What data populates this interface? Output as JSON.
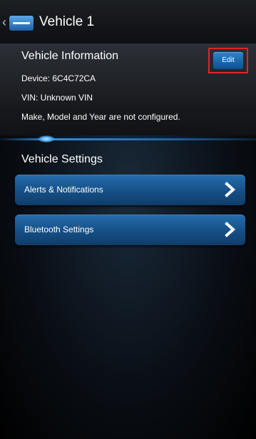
{
  "action_bar": {
    "title": "Vehicle 1",
    "up_caret": "‹"
  },
  "vehicle_information": {
    "header": "Vehicle Information",
    "device": "Device: 6C4C72CA",
    "vin": "VIN: Unknown VIN",
    "make_model_year": "Make, Model and Year are not configured.",
    "edit_label": "Edit"
  },
  "vehicle_settings": {
    "header": "Vehicle Settings",
    "items": [
      {
        "label": "Alerts & Notifications",
        "icon": "chevron-right-icon"
      },
      {
        "label": "Bluetooth Settings",
        "icon": "chevron-right-icon"
      }
    ]
  },
  "colors": {
    "accent_blue": "#1d6bb4",
    "highlight_red": "#e2222a"
  }
}
